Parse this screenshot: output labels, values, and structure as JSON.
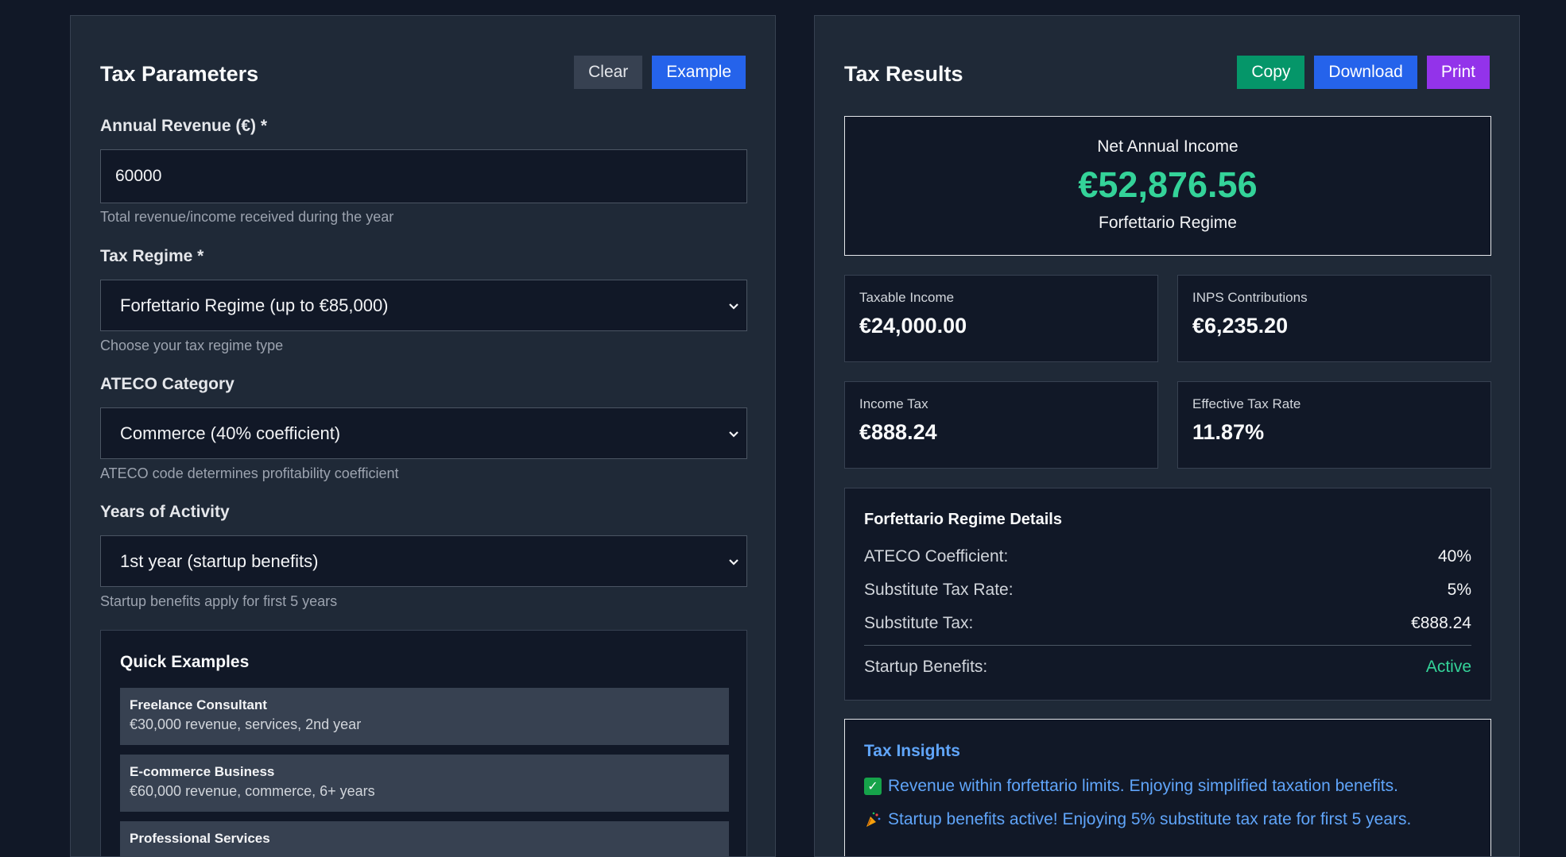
{
  "left": {
    "title": "Tax Parameters",
    "clear_label": "Clear",
    "example_label": "Example",
    "revenue": {
      "label": "Annual Revenue (€) *",
      "value": "60000",
      "help": "Total revenue/income received during the year"
    },
    "regime": {
      "label": "Tax Regime *",
      "value": "Forfettario Regime (up to €85,000)",
      "help": "Choose your tax regime type"
    },
    "ateco": {
      "label": "ATECO Category",
      "value": "Commerce (40% coefficient)",
      "help": "ATECO code determines profitability coefficient"
    },
    "years": {
      "label": "Years of Activity",
      "value": "1st year (startup benefits)",
      "help": "Startup benefits apply for first 5 years"
    },
    "quick": {
      "title": "Quick Examples",
      "items": [
        {
          "title": "Freelance Consultant",
          "desc": "€30,000 revenue, services, 2nd year"
        },
        {
          "title": "E-commerce Business",
          "desc": "€60,000 revenue, commerce, 6+ years"
        },
        {
          "title": "Professional Services",
          "desc": ""
        }
      ]
    }
  },
  "right": {
    "title": "Tax Results",
    "copy_label": "Copy",
    "download_label": "Download",
    "print_label": "Print",
    "net": {
      "label": "Net Annual Income",
      "value": "€52,876.56",
      "regime": "Forfettario Regime"
    },
    "stats": [
      {
        "label": "Taxable Income",
        "value": "€24,000.00"
      },
      {
        "label": "INPS Contributions",
        "value": "€6,235.20"
      },
      {
        "label": "Income Tax",
        "value": "€888.24"
      },
      {
        "label": "Effective Tax Rate",
        "value": "11.87%"
      }
    ],
    "details": {
      "title": "Forfettario Regime Details",
      "rows": [
        {
          "k": "ATECO Coefficient:",
          "v": "40%"
        },
        {
          "k": "Substitute Tax Rate:",
          "v": "5%"
        },
        {
          "k": "Substitute Tax:",
          "v": "€888.24"
        },
        {
          "k": "Startup Benefits:",
          "v": "Active"
        }
      ]
    },
    "insights": {
      "title": "Tax Insights",
      "items": [
        {
          "icon": "check-icon",
          "text": "Revenue within forfettario limits. Enjoying simplified taxation benefits."
        },
        {
          "icon": "party-popper-icon",
          "text": "Startup benefits active! Enjoying 5% substitute tax rate for first 5 years."
        }
      ]
    }
  },
  "colors": {
    "accent_green": "#34d399",
    "accent_blue": "#60a5fa",
    "btn_blue": "#2563eb",
    "btn_green": "#059669",
    "btn_purple": "#9333ea"
  }
}
